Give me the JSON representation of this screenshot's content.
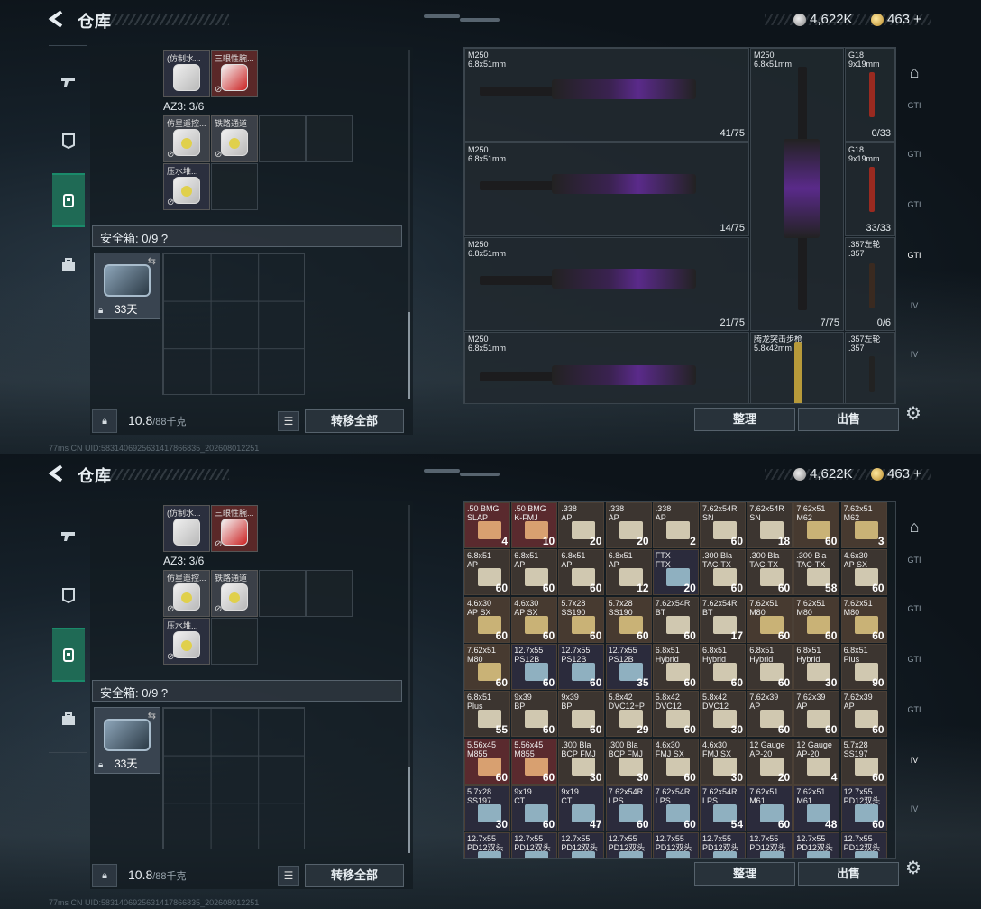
{
  "header": {
    "title": "仓库",
    "silver": "4,622K",
    "gold": "463",
    "gold_plus": "+"
  },
  "nav": {
    "icons": [
      "pistol-icon",
      "armor-icon",
      "backpack-icon",
      "case-icon"
    ]
  },
  "left": {
    "top_items": [
      {
        "label": "(仿制水...",
        "color": "blue"
      },
      {
        "label": "三眼性腕...",
        "color": "red"
      }
    ],
    "az3": "AZ3: 3/6",
    "az3_items": [
      {
        "label": "仿星遥控..."
      },
      {
        "label": "铁路通道"
      },
      {
        "label": "压水堆...  "
      }
    ],
    "safe_title": "安全箱: 0/9",
    "safe_help": "?",
    "case_days": "33天",
    "weight": "10.8",
    "weight_total": "/88千克",
    "transfer": "转移全部"
  },
  "status": {
    "ping": "77ms",
    "uid": "CN UID:5831406925631417866835_202608012251"
  },
  "weapons": [
    {
      "name": "M250",
      "cal": "6.8x51mm",
      "count": "41/75"
    },
    {
      "name": "M250",
      "cal": "6.8x51mm",
      "count": "14/75"
    },
    {
      "name": "M250",
      "cal": "6.8x51mm",
      "count": "21/75"
    },
    {
      "name": "M250",
      "cal": "6.8x51mm",
      "count": ""
    },
    {
      "name": "M250",
      "cal": "6.8x51mm",
      "count": "7/75"
    },
    {
      "name": "G18",
      "cal": "9x19mm",
      "count": "0/33"
    },
    {
      "name": "G18",
      "cal": "9x19mm",
      "count": "33/33"
    },
    {
      "name": ".357左轮",
      "cal": ".357",
      "count": "0/6"
    },
    {
      "name": "腾龙突击步枪",
      "cal": "5.8x42mm",
      "count": ""
    },
    {
      "name": ".357左轮",
      "cal": ".357",
      "count": ""
    }
  ],
  "buttons": {
    "sort": "整理",
    "sell": "出售"
  },
  "right_tabs": [
    "home-icon",
    "GTI",
    "GTI",
    "GTI",
    "GTI",
    "IV",
    "IV"
  ],
  "ammo": [
    [
      ".50 BMG\nSLAP",
      "4",
      0
    ],
    [
      ".50 BMG\nK-FMJ",
      "10",
      0
    ],
    [
      ".338\nAP",
      "20",
      1
    ],
    [
      ".338\nAP",
      "20",
      1
    ],
    [
      ".338\nAP",
      "2",
      1
    ],
    [
      "7.62x54R\nSN",
      "60",
      1
    ],
    [
      "7.62x54R\nSN",
      "18",
      1
    ],
    [
      "7.62x51\nM62",
      "60",
      2
    ],
    [
      "7.62x51\nM62",
      "3",
      2
    ],
    [
      "6.8x51\nAP",
      "60",
      1
    ],
    [
      "6.8x51\nAP",
      "60",
      1
    ],
    [
      "6.8x51\nAP",
      "60",
      1
    ],
    [
      "6.8x51\nAP",
      "12",
      1
    ],
    [
      "FTX\nFTX",
      "20",
      3
    ],
    [
      ".300 Bla\nTAC-TX",
      "60",
      1
    ],
    [
      ".300 Bla\nTAC-TX",
      "60",
      1
    ],
    [
      ".300 Bla\nTAC-TX",
      "58",
      1
    ],
    [
      "4.6x30\nAP SX",
      "60",
      1
    ],
    [
      "4.6x30\nAP SX",
      "60",
      2
    ],
    [
      "4.6x30\nAP SX",
      "60",
      2
    ],
    [
      "5.7x28\nSS190",
      "60",
      2
    ],
    [
      "5.7x28\nSS190",
      "60",
      2
    ],
    [
      "7.62x54R\nBT",
      "60",
      1
    ],
    [
      "7.62x54R\nBT",
      "17",
      1
    ],
    [
      "7.62x51\nM80",
      "60",
      2
    ],
    [
      "7.62x51\nM80",
      "60",
      2
    ],
    [
      "7.62x51\nM80",
      "60",
      2
    ],
    [
      "7.62x51\nM80",
      "60",
      2
    ],
    [
      "12.7x55\nPS12B",
      "60",
      3
    ],
    [
      "12.7x55\nPS12B",
      "60",
      3
    ],
    [
      "12.7x55\nPS12B",
      "35",
      3
    ],
    [
      "6.8x51\nHybrid",
      "60",
      1
    ],
    [
      "6.8x51\nHybrid",
      "60",
      1
    ],
    [
      "6.8x51\nHybrid",
      "60",
      1
    ],
    [
      "6.8x51\nHybrid",
      "30",
      1
    ],
    [
      "6.8x51\nPlus",
      "90",
      1
    ],
    [
      "6.8x51\nPlus",
      "55",
      1
    ],
    [
      "9x39\nBP",
      "60",
      1
    ],
    [
      "9x39\nBP",
      "60",
      1
    ],
    [
      "5.8x42\nDVC12+P",
      "29",
      1
    ],
    [
      "5.8x42\nDVC12",
      "60",
      1
    ],
    [
      "5.8x42\nDVC12",
      "30",
      1
    ],
    [
      "7.62x39\nAP",
      "60",
      1
    ],
    [
      "7.62x39\nAP",
      "60",
      1
    ],
    [
      "7.62x39\nAP",
      "60",
      1
    ],
    [
      "5.56x45\nM855",
      "60",
      0
    ],
    [
      "5.56x45\nM855",
      "60",
      0
    ],
    [
      ".300 Bla\nBCP FMJ",
      "30",
      1
    ],
    [
      ".300 Bla\nBCP FMJ",
      "30",
      1
    ],
    [
      "4.6x30\nFMJ SX",
      "60",
      1
    ],
    [
      "4.6x30\nFMJ SX",
      "30",
      1
    ],
    [
      "12 Gauge\nAP-20",
      "20",
      1
    ],
    [
      "12 Gauge\nAP-20",
      "4",
      1
    ],
    [
      "5.7x28\nSS197",
      "60",
      1
    ],
    [
      "5.7x28\nSS197",
      "30",
      3
    ],
    [
      "9x19\nCT",
      "60",
      3
    ],
    [
      "9x19\nCT",
      "47",
      3
    ],
    [
      "7.62x54R\nLPS",
      "60",
      3
    ],
    [
      "7.62x54R\nLPS",
      "60",
      3
    ],
    [
      "7.62x54R\nLPS",
      "54",
      3
    ],
    [
      "7.62x51\nM61",
      "60",
      3
    ],
    [
      "7.62x51\nM61",
      "48",
      3
    ],
    [
      "12.7x55\nPD12双头",
      "60",
      3
    ],
    [
      "12.7x55\nPD12双头",
      "",
      3
    ],
    [
      "12.7x55\nPD12双头",
      "",
      3
    ],
    [
      "12.7x55\nPD12双头",
      "",
      3
    ],
    [
      "12.7x55\nPD12双头",
      "",
      3
    ],
    [
      "12.7x55\nPD12双头",
      "",
      3
    ],
    [
      "12.7x55\nPD12双头",
      "",
      3
    ],
    [
      "12.7x55\nPD12双头",
      "",
      3
    ],
    [
      "12.7x55\nPD12双头",
      "",
      3
    ],
    [
      "12.7x55\nPD12双头",
      "",
      3
    ]
  ],
  "colors": {
    "accent": "#1f6a55",
    "red_cell": "#5a2a2e",
    "ammo_box": "#c9b276"
  }
}
